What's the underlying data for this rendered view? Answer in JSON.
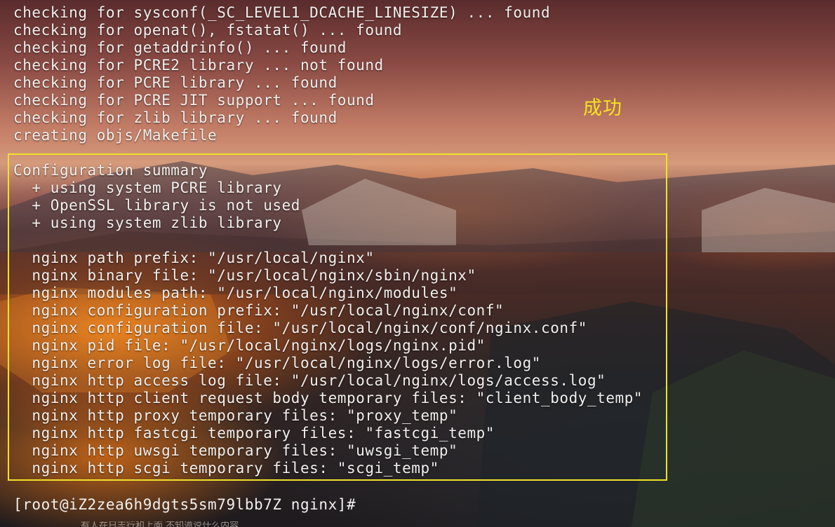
{
  "terminal": {
    "lines": [
      "checking for sysconf(_SC_LEVEL1_DCACHE_LINESIZE) ... found",
      "checking for openat(), fstatat() ... found",
      "checking for getaddrinfo() ... found",
      "checking for PCRE2 library ... not found",
      "checking for PCRE library ... found",
      "checking for PCRE JIT support ... found",
      "checking for zlib library ... found",
      "creating objs/Makefile",
      "",
      "Configuration summary",
      "  + using system PCRE library",
      "  + OpenSSL library is not used",
      "  + using system zlib library",
      "",
      "  nginx path prefix: \"/usr/local/nginx\"",
      "  nginx binary file: \"/usr/local/nginx/sbin/nginx\"",
      "  nginx modules path: \"/usr/local/nginx/modules\"",
      "  nginx configuration prefix: \"/usr/local/nginx/conf\"",
      "  nginx configuration file: \"/usr/local/nginx/conf/nginx.conf\"",
      "  nginx pid file: \"/usr/local/nginx/logs/nginx.pid\"",
      "  nginx error log file: \"/usr/local/nginx/logs/error.log\"",
      "  nginx http access log file: \"/usr/local/nginx/logs/access.log\"",
      "  nginx http client request body temporary files: \"client_body_temp\"",
      "  nginx http proxy temporary files: \"proxy_temp\"",
      "  nginx http fastcgi temporary files: \"fastcgi_temp\"",
      "  nginx http uwsgi temporary files: \"uwsgi_temp\"",
      "  nginx http scgi temporary files: \"scgi_temp\""
    ],
    "prompt": "[root@iZ2zea6h9dgts5sm79lbb7Z nginx]#",
    "cut_off_text": "有人在日志行和上面 不知道说什么内容"
  },
  "annotation": {
    "text": "成功"
  },
  "colors": {
    "text": "#f2f0ee",
    "highlight": "#f0e22a",
    "annotation": "#f5e21e"
  }
}
